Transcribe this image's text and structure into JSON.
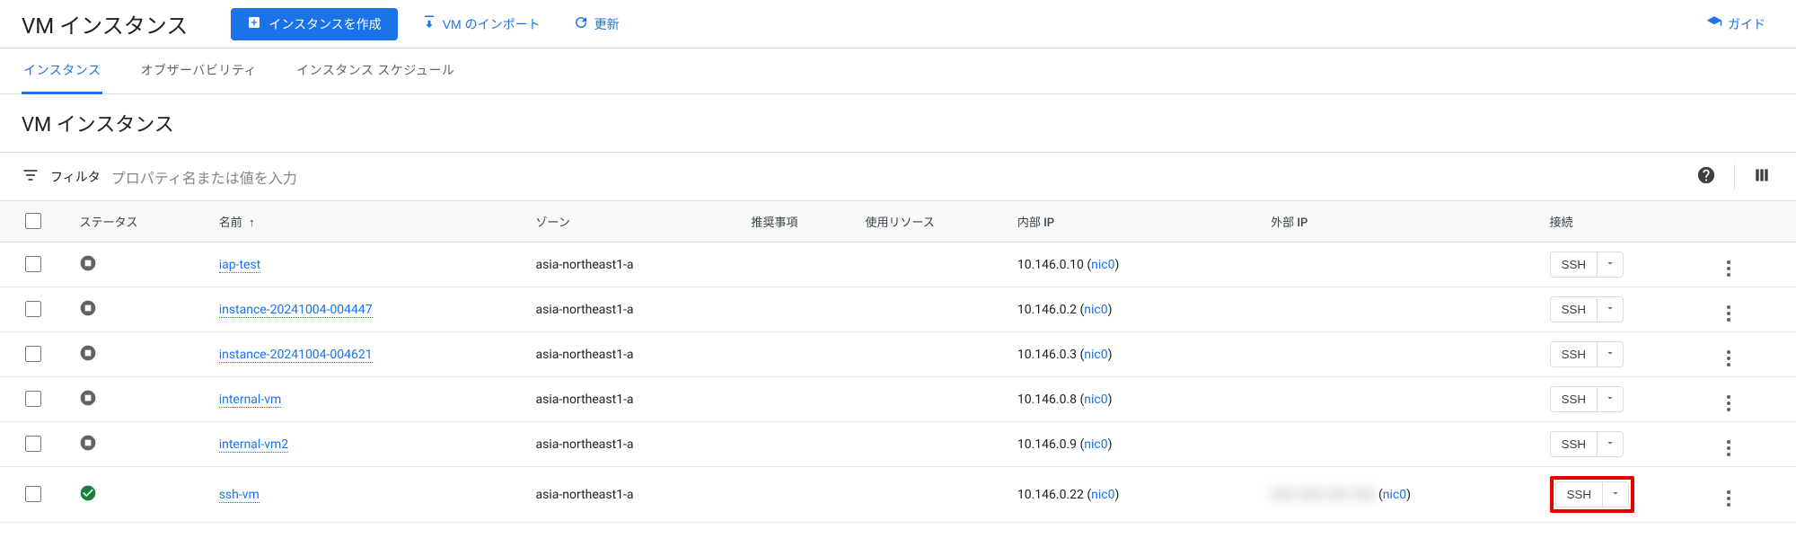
{
  "header": {
    "title": "VM インスタンス",
    "create_label": "インスタンスを作成",
    "import_label": "VM のインポート",
    "refresh_label": "更新",
    "guide_label": "ガイド"
  },
  "tabs": {
    "instances": "インスタンス",
    "observability": "オブザーバビリティ",
    "schedule": "インスタンス スケジュール"
  },
  "section_heading": "VM インスタンス",
  "filter": {
    "label": "フィルタ",
    "placeholder": "プロパティ名または値を入力"
  },
  "columns": {
    "status": "ステータス",
    "name": "名前",
    "zone": "ゾーン",
    "recommendation": "推奨事項",
    "resources": "使用リソース",
    "internal_ip": "内部 IP",
    "external_ip": "外部 IP",
    "connect": "接続"
  },
  "ssh_label": "SSH",
  "nic_label": "nic0",
  "rows": [
    {
      "status": "stopped",
      "name": "iap-test",
      "zone": "asia-northeast1-a",
      "internal_ip": "10.146.0.10",
      "external_ip": "",
      "highlight": false
    },
    {
      "status": "stopped",
      "name": "instance-20241004-004447",
      "zone": "asia-northeast1-a",
      "internal_ip": "10.146.0.2",
      "external_ip": "",
      "highlight": false
    },
    {
      "status": "stopped",
      "name": "instance-20241004-004621",
      "zone": "asia-northeast1-a",
      "internal_ip": "10.146.0.3",
      "external_ip": "",
      "highlight": false
    },
    {
      "status": "stopped",
      "name": "internal-vm",
      "zone": "asia-northeast1-a",
      "internal_ip": "10.146.0.8",
      "external_ip": "",
      "highlight": false
    },
    {
      "status": "stopped",
      "name": "internal-vm2",
      "zone": "asia-northeast1-a",
      "internal_ip": "10.146.0.9",
      "external_ip": "",
      "highlight": false
    },
    {
      "status": "running",
      "name": "ssh-vm",
      "zone": "asia-northeast1-a",
      "internal_ip": "10.146.0.22",
      "external_ip": "redacted",
      "highlight": true
    }
  ]
}
